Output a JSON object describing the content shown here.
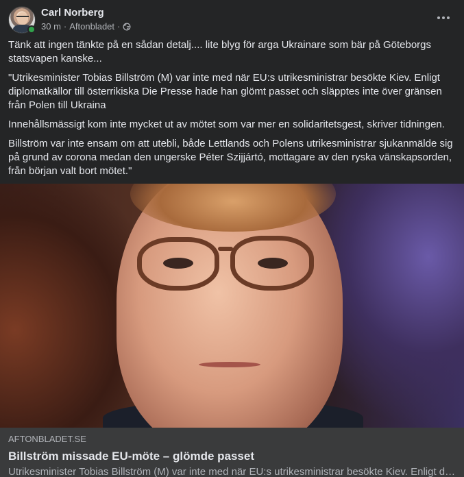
{
  "post": {
    "author": "Carl Norberg",
    "time": "30 m",
    "separator1": "·",
    "source": "Aftonbladet",
    "separator2": "·",
    "privacy_icon": "globe-icon",
    "paragraphs": [
      "Tänk att ingen tänkte på en sådan detalj.... lite blyg för arga Ukrainare som bär på Göteborgs statsvapen kanske...",
      "\"Utrikesminister Tobias Billström (M) var inte med när EU:s utrikesministrar besökte Kiev. Enligt diplomatkällor till österrikiska Die Presse hade han glömt passet och släpptes inte över gränsen från Polen till Ukraina",
      "Innehållsmässigt kom inte mycket ut av mötet som var mer en solidaritetsgest, skriver tidningen.",
      "Billström var inte ensam om att utebli, både Lettlands och Polens utrikesministrar sjukanmälde sig på grund av corona medan den ungerske Péter Szijjártó, mottagare av den ryska vänskapsorden, från början valt bort mötet.\""
    ]
  },
  "link_preview": {
    "domain": "AFTONBLADET.SE",
    "title": "Billström missade EU-möte – glömde passet",
    "description": "Utrikesminister Tobias Billström (M) var inte med när EU:s utrikesministrar besökte Kiev. Enligt diplomatkällor till österrikiska Die Presse hade han glömt passet"
  },
  "colors": {
    "background": "#242526",
    "online": "#31a24c",
    "link_footer": "#3a3b3c"
  }
}
